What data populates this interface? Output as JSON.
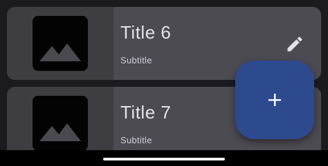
{
  "cards": [
    {
      "title": "Title 6",
      "subtitle": "Subtitle",
      "thumbnail_icon": "image-placeholder-icon",
      "action_icon": "edit-pencil-icon"
    },
    {
      "title": "Title 7",
      "subtitle": "Subtitle",
      "thumbnail_icon": "image-placeholder-icon"
    }
  ],
  "fab": {
    "icon": "plus-icon",
    "label": "+"
  },
  "colors": {
    "background": "#1b1a1f",
    "card": "#4d4b52",
    "card_media": "#3e3d42",
    "fab": "#2d4a8f",
    "text_primary": "#e4e2e8"
  }
}
